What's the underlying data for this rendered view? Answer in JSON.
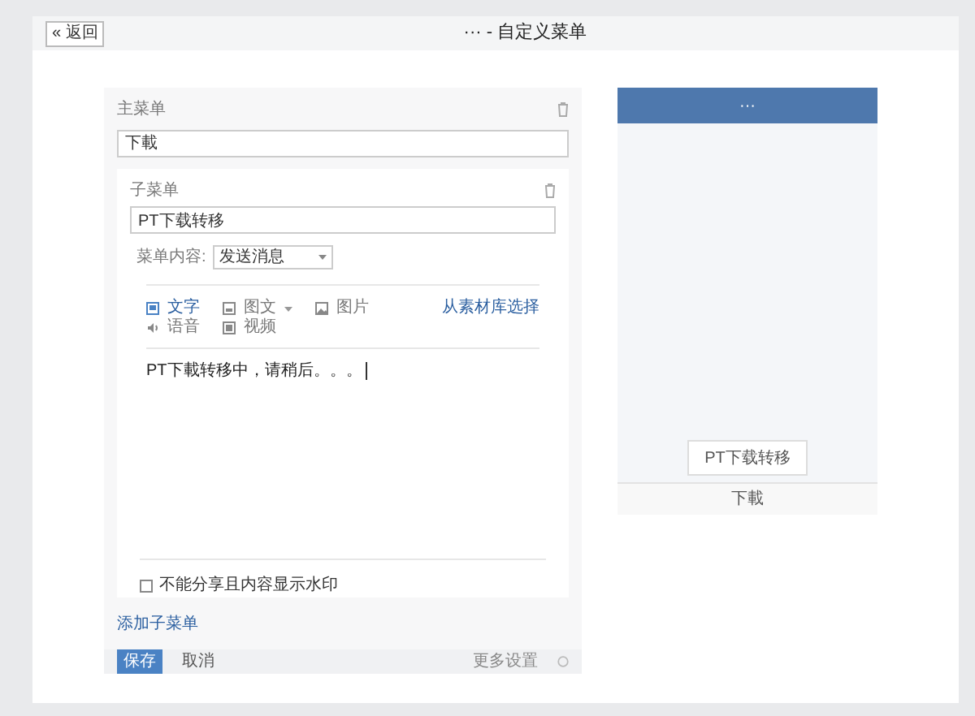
{
  "header": {
    "back_button": "« 返回",
    "title": "··· - 自定义菜单"
  },
  "main_menu": {
    "label": "主菜单",
    "value": "下載"
  },
  "sub_menu": {
    "label": "子菜单",
    "value": "PT下载转移"
  },
  "content_select": {
    "label": "菜单内容:",
    "value": "发送消息"
  },
  "message_types": [
    {
      "kind": "text",
      "label": "文字",
      "selected": true
    },
    {
      "kind": "news",
      "label": "图文",
      "selected": false
    },
    {
      "kind": "image",
      "label": "图片",
      "selected": false
    },
    {
      "kind": "voice",
      "label": "语音",
      "selected": false
    },
    {
      "kind": "video",
      "label": "视频",
      "selected": false
    }
  ],
  "library_link": "从素材库选择",
  "message_text": "PT下載转移中，请稍后。。。",
  "watermark_option": {
    "label": "不能分享且内容显示水印",
    "checked": false
  },
  "add_submenu": "添加子菜单",
  "footer": {
    "save": "保存",
    "cancel": "取消",
    "more_settings": "更多设置"
  },
  "preview": {
    "title": "···",
    "popup_item": "PT下载转移",
    "menu_item": "下載"
  }
}
